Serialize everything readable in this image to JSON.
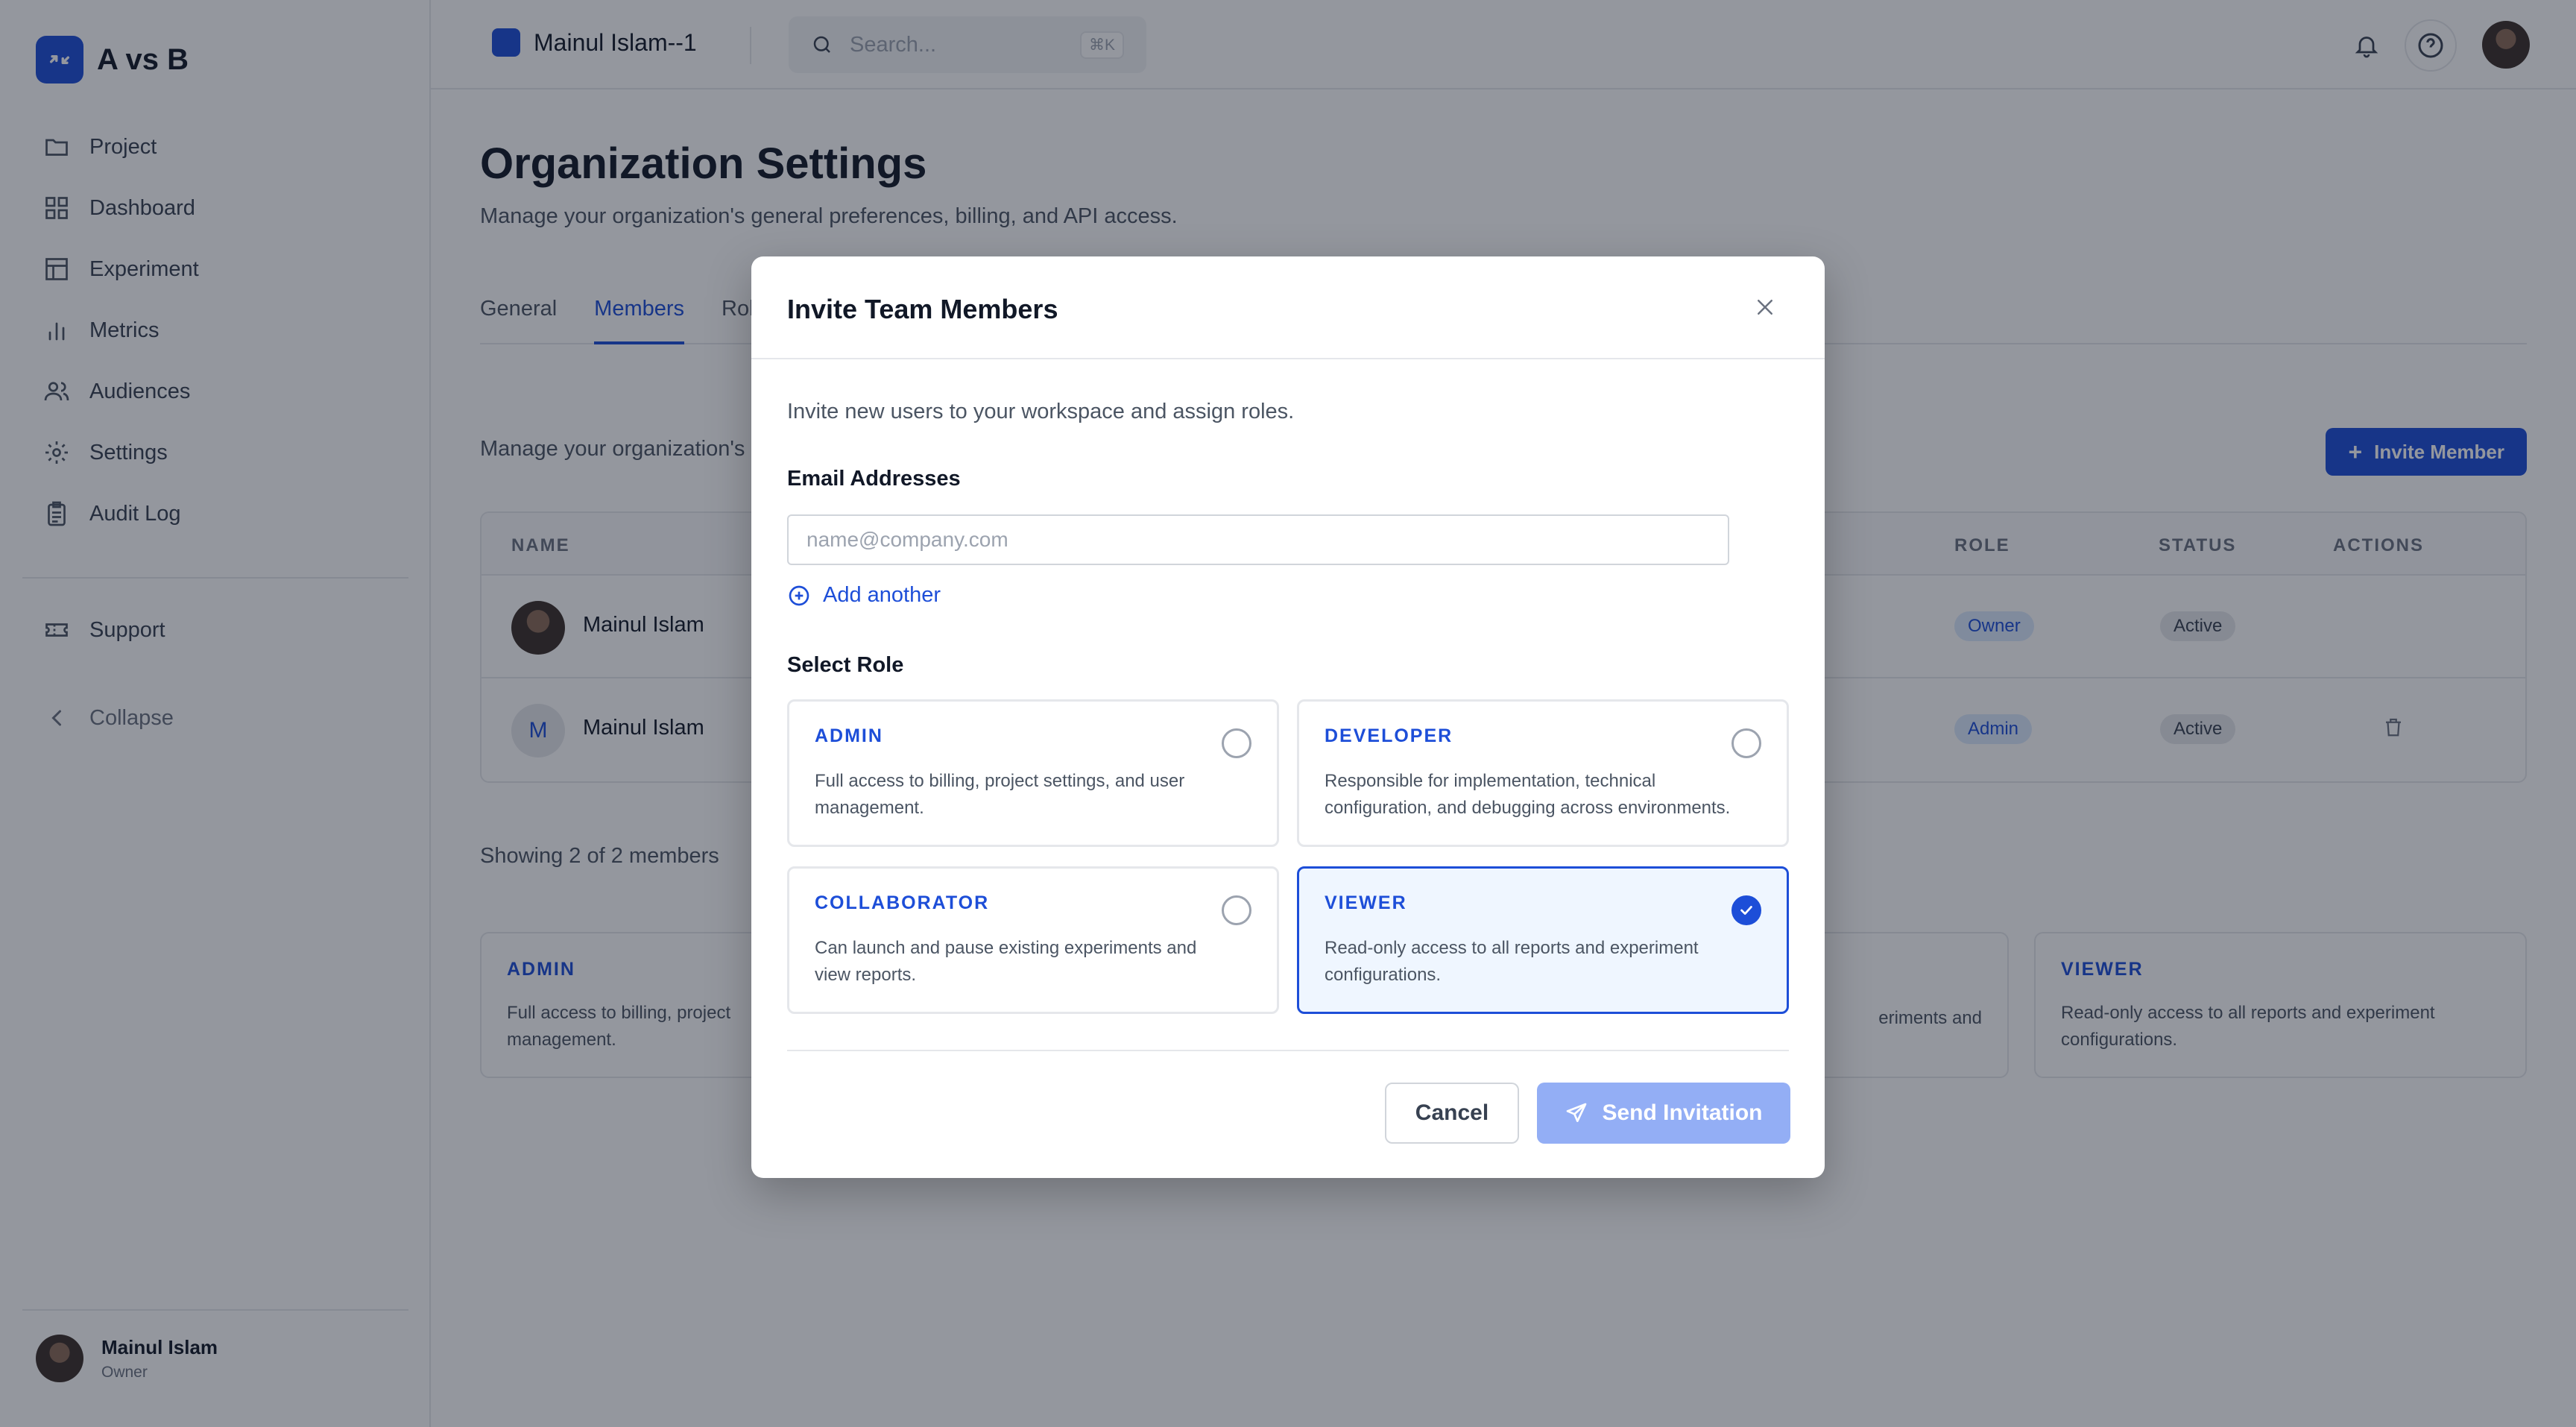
{
  "app": {
    "name": "A vs B"
  },
  "sidebar": {
    "items": [
      {
        "label": "Project",
        "icon": "folder-icon"
      },
      {
        "label": "Dashboard",
        "icon": "grid-icon"
      },
      {
        "label": "Experiment",
        "icon": "table-icon"
      },
      {
        "label": "Metrics",
        "icon": "bar-chart-icon"
      },
      {
        "label": "Audiences",
        "icon": "users-icon"
      },
      {
        "label": "Settings",
        "icon": "gear-icon"
      },
      {
        "label": "Audit Log",
        "icon": "clipboard-icon"
      }
    ],
    "support": "Support",
    "collapse": "Collapse",
    "user": {
      "name": "Mainul Islam",
      "role": "Owner"
    }
  },
  "topbar": {
    "project_name": "Mainul Islam--1",
    "search_placeholder": "Search...",
    "search_shortcut": "⌘K"
  },
  "page": {
    "title": "Organization Settings",
    "subtitle": "Manage your organization's general preferences, billing, and API access.",
    "tabs": [
      "General",
      "Members",
      "Rol"
    ],
    "active_tab": "Members",
    "manage_text": "Manage your organization's",
    "invite_button": "Invite Member",
    "table": {
      "headers": {
        "name": "NAME",
        "role": "ROLE",
        "status": "STATUS",
        "actions": "ACTIONS"
      },
      "rows": [
        {
          "name": "Mainul Islam",
          "role": "Owner",
          "status": "Active",
          "initial": ""
        },
        {
          "name": "Mainul Islam",
          "role": "Admin",
          "status": "Active",
          "initial": "M"
        }
      ]
    },
    "showing": "Showing 2 of 2 members",
    "role_cards": [
      {
        "title": "ADMIN",
        "desc": "Full access to billing, project",
        "desc2": "management."
      },
      {
        "title": "",
        "desc": "",
        "desc2": ""
      },
      {
        "title": "",
        "desc": "eriments and",
        "desc2": ""
      },
      {
        "title": "VIEWER",
        "desc": "Read-only access to all reports and experiment",
        "desc2": "configurations."
      }
    ]
  },
  "modal": {
    "title": "Invite Team Members",
    "subtitle": "Invite new users to your workspace and assign roles.",
    "email_label": "Email Addresses",
    "email_placeholder": "name@company.com",
    "email_value": "",
    "add_another": "Add another",
    "select_role_label": "Select Role",
    "roles": [
      {
        "title": "ADMIN",
        "desc": "Full access to billing, project settings, and user management.",
        "selected": false
      },
      {
        "title": "DEVELOPER",
        "desc": "Responsible for implementation, technical configuration, and debugging across environments.",
        "selected": false
      },
      {
        "title": "COLLABORATOR",
        "desc": "Can launch and pause existing experiments and view reports.",
        "selected": false
      },
      {
        "title": "VIEWER",
        "desc": "Read-only access to all reports and experiment configurations.",
        "selected": true
      }
    ],
    "cancel": "Cancel",
    "send": "Send Invitation"
  },
  "colors": {
    "accent": "#1d4ed8",
    "send_disabled": "#93aef5",
    "selected_bg": "#eff6ff"
  }
}
